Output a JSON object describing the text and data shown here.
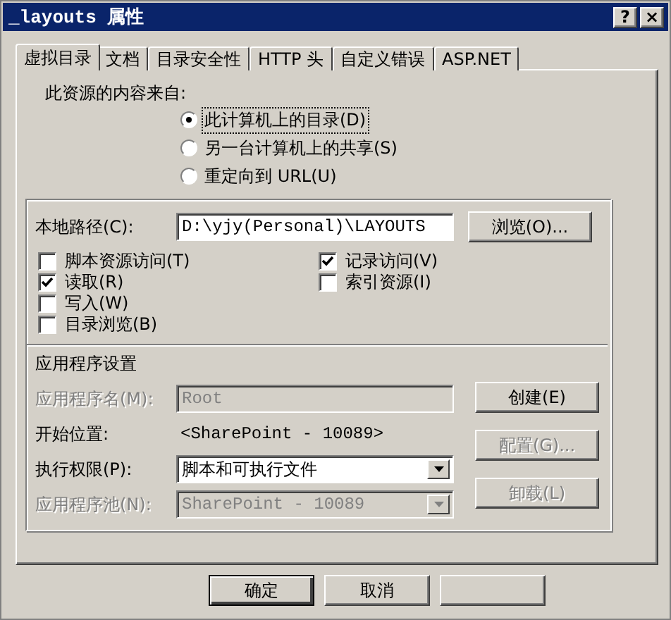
{
  "window": {
    "title": "_layouts 属性",
    "controls": [
      "?",
      "×"
    ]
  },
  "tabs": [
    {
      "label": "虚拟目录",
      "selected": true
    },
    {
      "label": "文档",
      "selected": false
    },
    {
      "label": "目录安全性",
      "selected": false
    },
    {
      "label": "HTTP 头",
      "selected": false
    },
    {
      "label": "自定义错误",
      "selected": false
    },
    {
      "label": "ASP.NET",
      "selected": false
    }
  ],
  "source": {
    "label": "此资源的内容来自:",
    "options": [
      {
        "label": "此计算机上的目录(D)",
        "selected": true
      },
      {
        "label": "另一台计算机上的共享(S)",
        "selected": false
      },
      {
        "label": "重定向到 URL(U)",
        "selected": false
      }
    ]
  },
  "local_path": {
    "label": "本地路径(C):",
    "value": "D:\\yjy(Personal)\\LAYOUTS",
    "button": "浏览(O)..."
  },
  "left_checks": [
    {
      "label": "脚本资源访问(T)",
      "checked": false
    },
    {
      "label": "读取(R)",
      "checked": true
    },
    {
      "label": "写入(W)",
      "checked": false
    },
    {
      "label": "目录浏览(B)",
      "checked": false
    }
  ],
  "right_checks": [
    {
      "label": "记录访问(V)",
      "checked": true
    },
    {
      "label": "索引资源(I)",
      "checked": false
    }
  ],
  "app_settings": {
    "heading": "应用程序设置",
    "rows": [
      {
        "kind": "input",
        "label": "应用程序名(M):",
        "value": "Root",
        "disabled": true
      },
      {
        "kind": "text",
        "label": "开始位置:",
        "value": "<SharePoint - 10089>",
        "disabled": false
      },
      {
        "kind": "select",
        "label": "执行权限(P):",
        "value": "脚本和可执行文件",
        "disabled": false
      },
      {
        "kind": "select",
        "label": "应用程序池(N):",
        "value": "SharePoint - 10089",
        "disabled": true
      }
    ],
    "buttons": [
      {
        "label": "创建(E)",
        "disabled": false
      },
      {
        "label": "配置(G)...",
        "disabled": true
      },
      {
        "label": "卸载(L)",
        "disabled": true
      }
    ]
  },
  "dialog_buttons": [
    {
      "label": "确定",
      "default": true
    },
    {
      "label": "取消",
      "default": false
    }
  ]
}
